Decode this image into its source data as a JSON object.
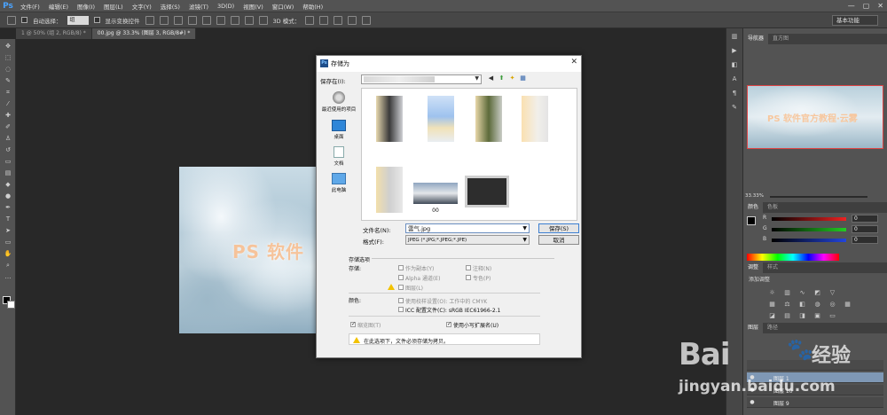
{
  "menubar": {
    "logo": "Ps",
    "items": [
      "文件(F)",
      "编辑(E)",
      "图像(I)",
      "图层(L)",
      "文字(Y)",
      "选择(S)",
      "滤镜(T)",
      "3D(D)",
      "视图(V)",
      "窗口(W)",
      "帮助(H)"
    ],
    "win_controls": [
      "—",
      "▢",
      "✕"
    ]
  },
  "optbar": {
    "auto_select_label": "自动选择：",
    "auto_select_value": "组",
    "show_transform_label": "显示变换控件",
    "mode_3d_label": "3D 模式：",
    "workspace": "基本功能"
  },
  "tabs": [
    {
      "label": "1 @ 50% (组 2, RGB/8) *"
    },
    {
      "label": "00.jpg @ 33.3% (图层 3, RGB/8#) *"
    }
  ],
  "canvas": {
    "text": "PS 软件"
  },
  "dialog": {
    "title": "存储为",
    "close": "✕",
    "save_in_label": "保存在(I):",
    "places": [
      {
        "label": "最近使用的项目",
        "icon": "recent-places-icon"
      },
      {
        "label": "桌面",
        "icon": "desktop-icon"
      },
      {
        "label": "文档",
        "icon": "documents-icon"
      },
      {
        "label": "此电脑",
        "icon": "computer-icon"
      }
    ],
    "files": [
      {
        "label": ""
      },
      {
        "label": ""
      },
      {
        "label": ""
      },
      {
        "label": ""
      },
      {
        "label": ""
      },
      {
        "label": "00"
      },
      {
        "label": ""
      }
    ],
    "filename_label": "文件名(N):",
    "filename_value": "雲气.jpg",
    "format_label": "格式(F):",
    "format_value": "JPEG (*.JPG;*.JPEG;*.JPE)",
    "save_button": "保存(S)",
    "cancel_button": "取消",
    "options": {
      "heading": "存储选项",
      "store_label": "存储:",
      "as_copy": "作为副本(Y)",
      "notes": "注释(N)",
      "alpha": "Alpha 通道(E)",
      "spot": "专色(P)",
      "layers": "图层(L)",
      "color_label": "颜色:",
      "use_proof": "使用校样设置(O): 工作中的 CMYK",
      "icc": "ICC 配置文件(C): sRGB IEC61966-2.1",
      "thumbnail": "缩览图(T)",
      "lowercase_ext": "使用小写扩展名(U)",
      "warning": "在此选项下，文件必须存储为拷贝。"
    }
  },
  "right_panel": {
    "nav_tabs": [
      "导航器",
      "直方图"
    ],
    "zoom": "33.33%",
    "color_tabs": [
      "颜色",
      "色板"
    ],
    "channels": [
      {
        "label": "R",
        "value": "0",
        "color": "#cc2222"
      },
      {
        "label": "G",
        "value": "0",
        "color": "#22aa22"
      },
      {
        "label": "B",
        "value": "0",
        "color": "#2244cc"
      }
    ],
    "adj_tabs": [
      "调整",
      "样式"
    ],
    "adj_title": "添加调整",
    "layer_tabs": [
      "图层",
      "路径"
    ],
    "layers": [
      {
        "name": "图层 1",
        "selected": true
      },
      {
        "name": "图层 10",
        "selected": false
      },
      {
        "name": "图层 9",
        "selected": false
      }
    ]
  },
  "watermark": {
    "logo": "Bai",
    "logo_cn": "经验",
    "url": "jingyan.baidu.com"
  }
}
